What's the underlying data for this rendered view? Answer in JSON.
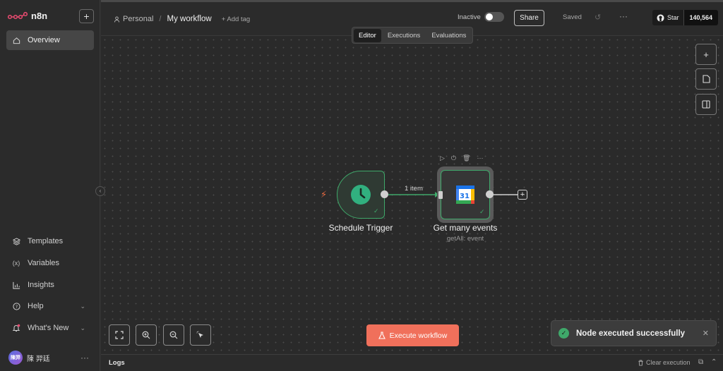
{
  "app": {
    "logo_text": "n8n"
  },
  "sidebar": {
    "top_items": [
      {
        "label": "Overview",
        "icon": "home-icon"
      }
    ],
    "bottom_items": [
      {
        "label": "Templates",
        "icon": "templates-icon"
      },
      {
        "label": "Variables",
        "icon": "variables-icon"
      },
      {
        "label": "Insights",
        "icon": "insights-icon"
      },
      {
        "label": "Help",
        "icon": "help-icon"
      },
      {
        "label": "What's New",
        "icon": "bell-icon"
      }
    ],
    "user": {
      "initials": "陳羿",
      "name": "陳 羿廷"
    }
  },
  "header": {
    "breadcrumb_project": "Personal",
    "breadcrumb_separator": "/",
    "workflow_name": "My workflow",
    "add_tag": "+ Add tag",
    "status_label": "Inactive",
    "share_label": "Share",
    "saved_label": "Saved",
    "github": {
      "star_label": "Star",
      "count": "140,564"
    }
  },
  "tabs": [
    "Editor",
    "Executions",
    "Evaluations"
  ],
  "nodes": {
    "trigger": {
      "label": "Schedule Trigger",
      "icon": "clock-icon"
    },
    "calendar": {
      "label": "Get many events",
      "subtitle": "getAll: event",
      "icon": "google-calendar-icon",
      "icon_text": "31"
    },
    "connection_label": "1 item"
  },
  "canvas": {
    "execute_label": "Execute workflow"
  },
  "toast": {
    "message": "Node executed successfully"
  },
  "logs": {
    "title": "Logs",
    "clear_label": "Clear execution"
  },
  "colors": {
    "accent": "#f0705b",
    "success": "#3fa86a"
  }
}
